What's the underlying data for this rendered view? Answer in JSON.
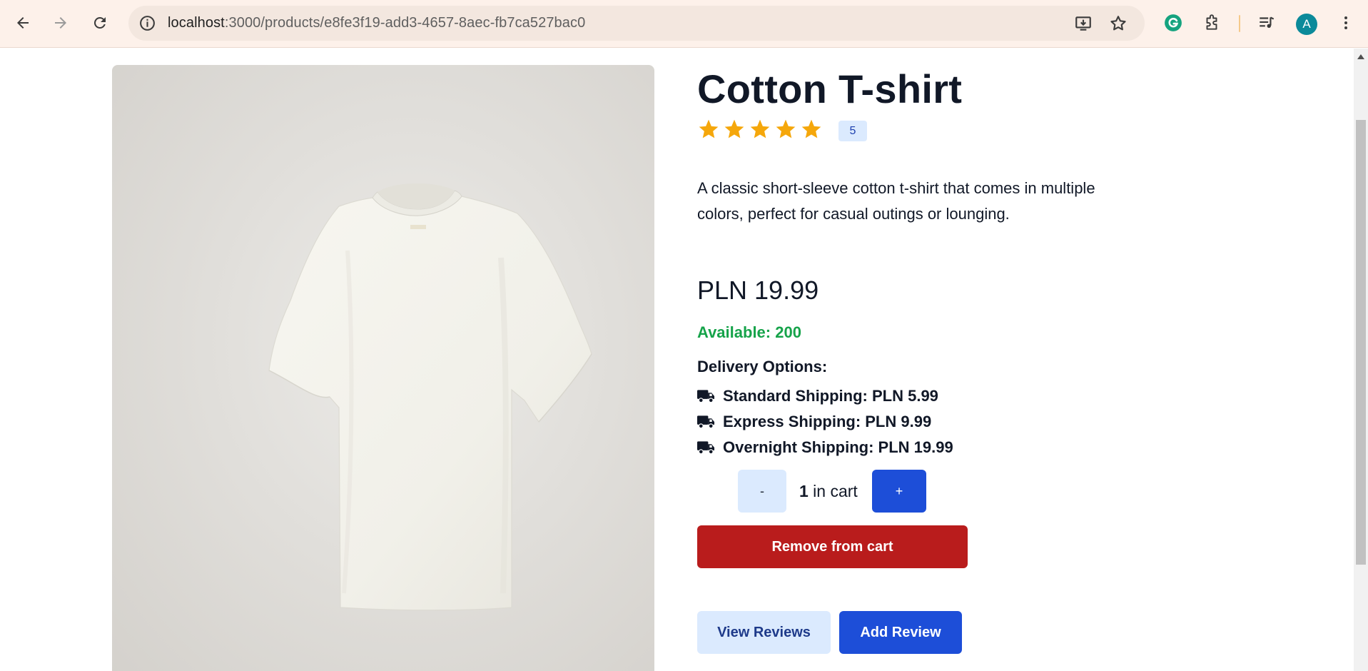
{
  "browser": {
    "url_host": "localhost",
    "url_path": ":3000/products/e8fe3f19-add3-4657-8aec-fb7ca527bac0",
    "profile_initial": "A",
    "icons": {
      "back": "arrow-left-icon",
      "forward": "arrow-right-icon",
      "reload": "reload-icon",
      "site_info": "info-icon",
      "install": "install-app-icon",
      "bookmark": "star-outline-icon",
      "grammarly": "grammarly-icon",
      "extensions": "puzzle-icon",
      "media": "media-queue-icon",
      "menu": "kebab-menu-icon"
    },
    "colors": {
      "toolbar": "#fdf1ea",
      "omnibox": "#f3e7df",
      "avatar": "#0b8a9a"
    }
  },
  "product": {
    "title": "Cotton T-shirt",
    "rating_stars": 5,
    "rating_count": "5",
    "description": "A classic short-sleeve cotton t-shirt that comes in multiple colors, perfect for casual outings or lounging.",
    "price": "PLN 19.99",
    "available": "Available: 200",
    "image": "white-tshirt-photo"
  },
  "delivery": {
    "title": "Delivery Options:",
    "options": [
      {
        "label": "Standard Shipping: PLN 5.99",
        "icon": "truck-icon"
      },
      {
        "label": "Express Shipping: PLN 9.99",
        "icon": "truck-icon"
      },
      {
        "label": "Overnight Shipping: PLN 19.99",
        "icon": "truck-icon"
      }
    ]
  },
  "cart": {
    "minus_label": "-",
    "plus_label": "+",
    "quantity": "1",
    "quantity_suffix": " in cart",
    "remove_label": "Remove from cart"
  },
  "reviews": {
    "view_label": "View Reviews",
    "add_label": "Add Review"
  },
  "colors": {
    "star": "#f5a70b",
    "available": "#16a34a",
    "primary": "#1d4ed8",
    "primary_light": "#dbeafe",
    "danger": "#b91c1c"
  }
}
